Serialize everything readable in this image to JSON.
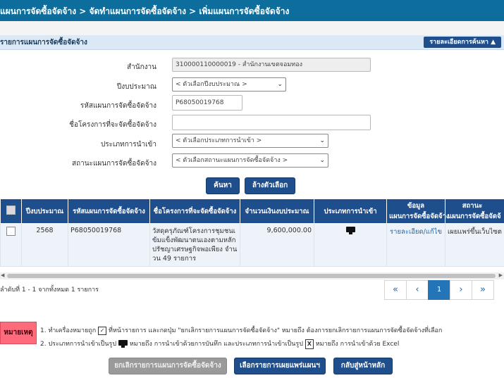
{
  "breadcrumb": "แผนการจัดซื้อจัดจ้าง > จัดทำแผนการจัดซื้อจัดจ้าง > เพิ่มแผนการจัดซื้อจัดจ้าง",
  "panel": {
    "title": "รายการแผนการจัดซื้อจัดจ้าง",
    "search_detail_button": "รายละเอียดการค้นหา ▲"
  },
  "form": {
    "agency_label": "สำนักงาน",
    "agency_value": "310000110000019 - สำนักงานเขตจอมทอง",
    "budget_year_label": "ปีงบประมาณ",
    "budget_year_value": "< ตัวเลือกปีงบประมาณ >",
    "plan_code_label": "รหัสแผนการจัดซื้อจัดจ้าง",
    "plan_code_value": "P68050019768",
    "project_name_label": "ชื่อโครงการที่จะจัดซื้อจัดจ้าง",
    "project_name_value": "",
    "import_type_label": "ประเภทการนำเข้า",
    "import_type_value": "< ตัวเลือกประเภทการนำเข้า >",
    "status_label": "สถานะแผนการจัดซื้อจัดจ้าง",
    "status_value": "< ตัวเลือกสถานะแผนการจัดซื้อจัดจ้าง >",
    "search_button": "ค้นหา",
    "clear_button": "ล้างตัวเลือก"
  },
  "table": {
    "headers": [
      "ปีงบประมาณ",
      "รหัสแผนการจัดซื้อจัดจ้าง",
      "ชื่อโครงการที่จะจัดซื้อจัดจ้าง",
      "จำนวนเงินงบประมาณ",
      "ประเภทการนำเข้า",
      "ข้อมูล",
      "แผนการจัดซื้อจัดจ้าง",
      "สถานะ",
      "แผนการจัดซื้อจัดจ้"
    ],
    "rows": [
      {
        "year": "2568",
        "code": "P68050019768",
        "name": "วัสดุครุภัณฑ์โครงการชุมชนเข้มแข็งพัฒนาตนเองตามหลักปรัชญาเศรษฐกิจพอเพียง จำนวน 49 รายการ",
        "amount": "9,600,000.00",
        "import_icon": "monitor-icon",
        "detail_link": "รายละเอียด/แก้ไข",
        "status": "เผยแพร่ขึ้นเว็บไซต"
      }
    ]
  },
  "status_text": "ลำดับที่ 1 - 1 จากทั้งหมด 1 รายการ",
  "pager": {
    "first": "«",
    "prev": "‹",
    "current": "1",
    "next": "›",
    "last": "»"
  },
  "notes": {
    "badge": "หมายเหตุ",
    "line1_a": "1. ทำเครื่องหมายถูก",
    "line1_b": "ที่หน้ารายการ และกดปุ่ม \"ยกเลิกรายการแผนการจัดซื้อจัดจ้าง\" หมายถึง ต้องการยกเลิกรายการแผนการจัดซื้อจัดจ้างที่เลือก",
    "line2_a": "2. ประเภทการนำเข้าเป็นรูป",
    "line2_b": "หมายถึง การนำเข้าด้วยการบันทึก และประเภทการนำเข้าเป็นรูป",
    "line2_c": "หมายถึง การนำเข้าด้วย Excel"
  },
  "actions": {
    "cancel": "ยกเลิกรายการแผนการจัดซื้อจัดจ้าง",
    "publish": "เลือกรายการเผยแพร่แผนฯ",
    "home": "กลับสู่หน้าหลัก"
  },
  "colors": {
    "header_blue": "#0d6e9e",
    "button_blue": "#1f4e8c",
    "note_red": "#ff6b7a"
  }
}
